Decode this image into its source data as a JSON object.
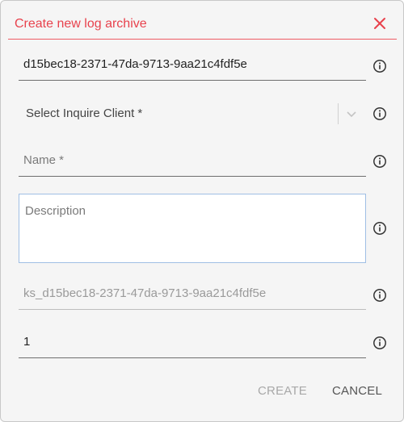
{
  "dialog": {
    "title": "Create new log archive",
    "close_icon": "close-icon"
  },
  "fields": {
    "id": {
      "value": "d15bec18-2371-47da-9713-9aa21c4fdf5e"
    },
    "client": {
      "label": "Select Inquire Client *"
    },
    "name": {
      "placeholder": "Name *",
      "value": ""
    },
    "description": {
      "placeholder": "Description",
      "value": ""
    },
    "key": {
      "value": "ks_d15bec18-2371-47da-9713-9aa21c4fdf5e"
    },
    "count": {
      "value": "1"
    }
  },
  "icons": {
    "info": "info-icon",
    "chevron": "chevron-down-icon"
  },
  "colors": {
    "accent": "#e8424d",
    "focus_border": "#9fbfe4"
  },
  "actions": {
    "create_label": "CREATE",
    "cancel_label": "CANCEL"
  }
}
